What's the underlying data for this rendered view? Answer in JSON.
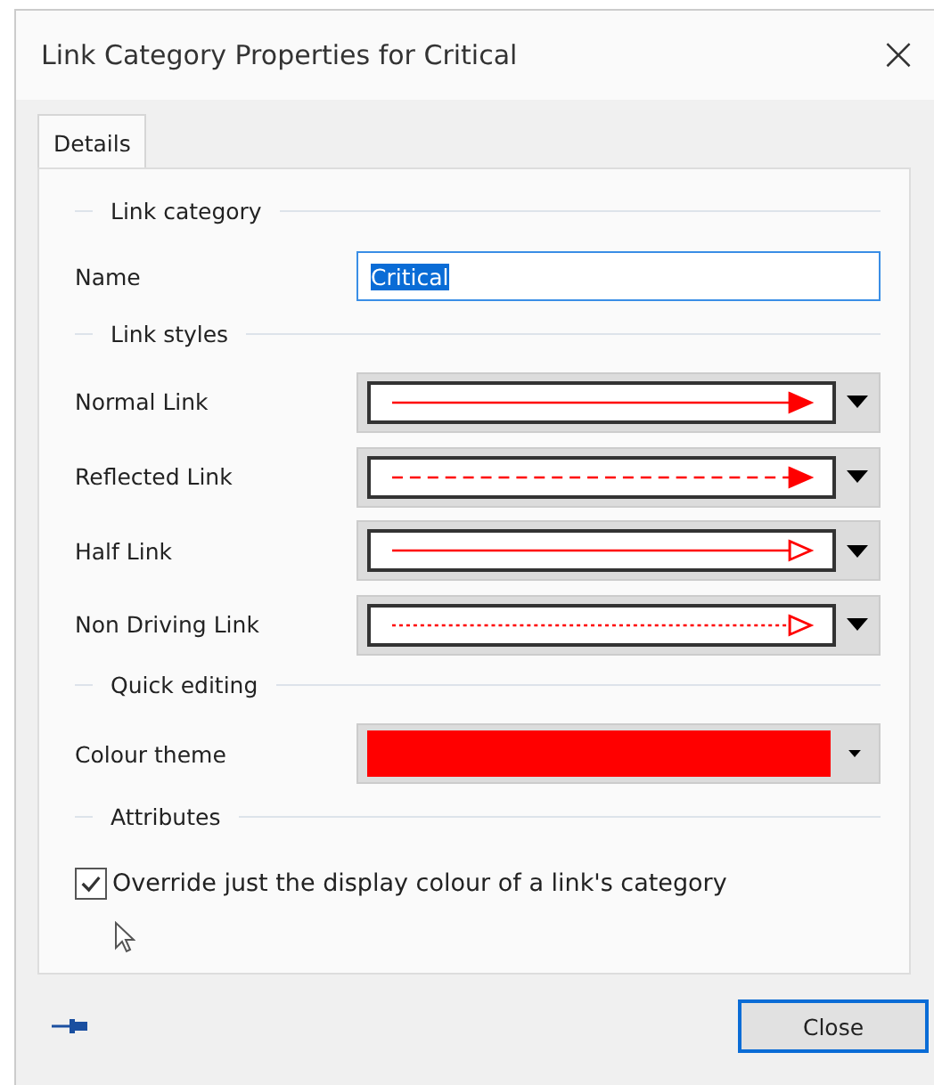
{
  "window": {
    "title": "Link Category Properties for Critical",
    "close": "×"
  },
  "tabs": [
    {
      "label": "Details",
      "selected": true
    }
  ],
  "sections": [
    {
      "heading": "Link category",
      "rows": [
        {
          "kind": "text",
          "label": "Name",
          "value": "Critical",
          "text_selected": true
        }
      ]
    },
    {
      "heading": "Link styles",
      "rows": [
        {
          "kind": "link",
          "label": "Normal Link",
          "dashed": false,
          "dotted": false,
          "hollow_head": false,
          "color": "#ff0000"
        },
        {
          "kind": "link",
          "label": "Reflected Link",
          "dashed": true,
          "dotted": false,
          "hollow_head": false,
          "color": "#ff0000"
        },
        {
          "kind": "link",
          "label": "Half Link",
          "dashed": false,
          "dotted": false,
          "hollow_head": true,
          "color": "#ff0000"
        },
        {
          "kind": "link",
          "label": "Non Driving Link",
          "dashed": false,
          "dotted": true,
          "hollow_head": true,
          "color": "#ff0000"
        }
      ]
    },
    {
      "heading": "Quick editing",
      "rows": [
        {
          "kind": "colour",
          "label": "Colour theme",
          "color": "#ff0000"
        }
      ]
    },
    {
      "heading": "Attributes",
      "rows": [
        {
          "kind": "checkbox",
          "label": "Override just the display colour of a link's category",
          "checked": true
        }
      ]
    }
  ],
  "buttons": [
    {
      "label": "Close",
      "default": true
    }
  ]
}
